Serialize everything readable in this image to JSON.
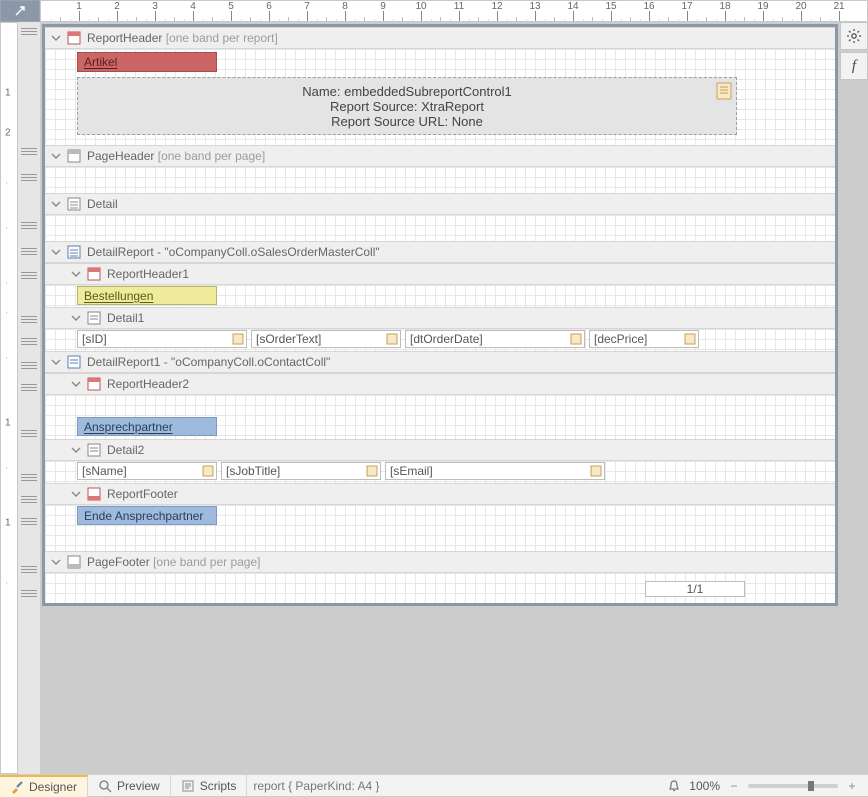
{
  "bottom": {
    "tabs": {
      "designer": "Designer",
      "preview": "Preview",
      "scripts": "Scripts"
    },
    "status": "report { PaperKind: A4 }",
    "zoom_pct": "100%"
  },
  "bands": {
    "reportHeader": {
      "label": "ReportHeader",
      "extra": "[one band per report]",
      "cell_artikel": "Artikel",
      "sub_name": "Name: embeddedSubreportControl1",
      "sub_src": "Report Source: XtraReport",
      "sub_url": "Report Source URL: None"
    },
    "pageHeader": {
      "label": "PageHeader",
      "extra": "[one band per page]"
    },
    "detail": {
      "label": "Detail"
    },
    "detailReport": {
      "label": "DetailReport - \"oCompanyColl.oSalesOrderMasterColl\"",
      "rh1": "ReportHeader1",
      "bestellungen": "Bestellungen",
      "detail1": "Detail1",
      "fields": {
        "sID": "[sID]",
        "sOrderText": "[sOrderText]",
        "dtOrderDate": "[dtOrderDate]",
        "decPrice": "[decPrice]"
      }
    },
    "detailReport1": {
      "label": "DetailReport1 - \"oCompanyColl.oContactColl\"",
      "rh2": "ReportHeader2",
      "ansprech": "Ansprechpartner",
      "detail2": "Detail2",
      "fields": {
        "sName": "[sName]",
        "sJobTitle": "[sJobTitle]",
        "sEmail": "[sEmail]"
      },
      "footer": "ReportFooter",
      "ende": "Ende Ansprechpartner"
    },
    "pageFooter": {
      "label": "PageFooter",
      "extra": "[one band per page]",
      "pagenum": "1/1"
    }
  }
}
